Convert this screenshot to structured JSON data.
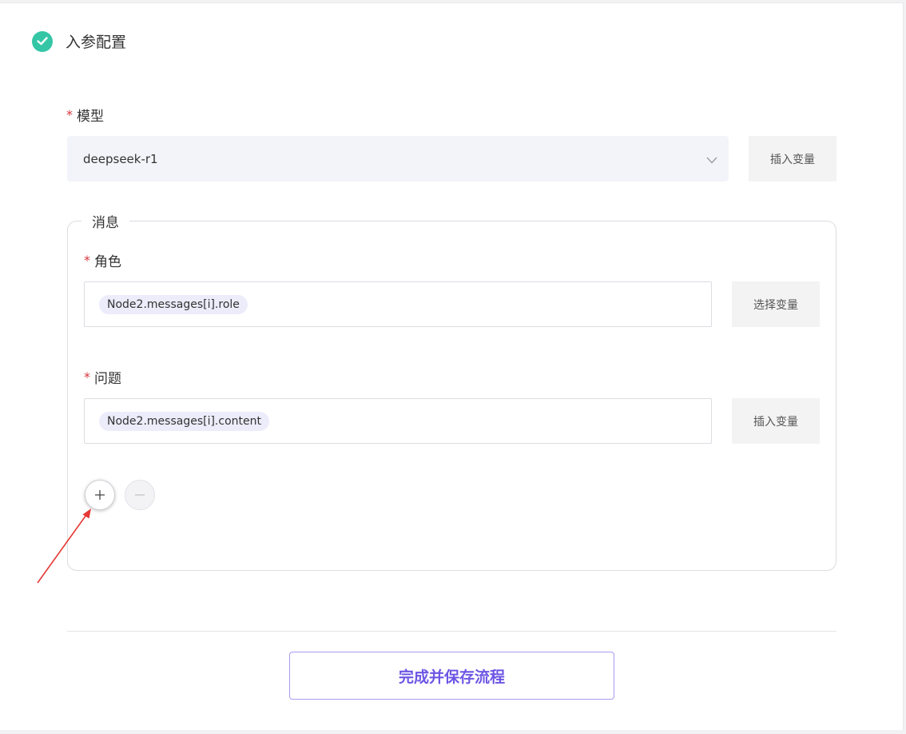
{
  "section": {
    "title": "入参配置"
  },
  "model": {
    "required_mark": "*",
    "label": "模型",
    "value": "deepseek-r1",
    "insert_button": "插入变量"
  },
  "messages": {
    "legend": "消息",
    "role": {
      "required_mark": "*",
      "label": "角色",
      "tag": "Node2.messages[i].role",
      "button": "选择变量"
    },
    "question": {
      "required_mark": "*",
      "label": "问题",
      "tag": "Node2.messages[i].content",
      "button": "插入变量"
    },
    "add_icon": "plus-icon",
    "remove_icon": "minus-icon"
  },
  "footer": {
    "save_button": "完成并保存流程"
  },
  "colors": {
    "check": "#35c6a6",
    "accent": "#6c56e4",
    "required": "#d9363e",
    "annotation_arrow": "#e53935"
  }
}
